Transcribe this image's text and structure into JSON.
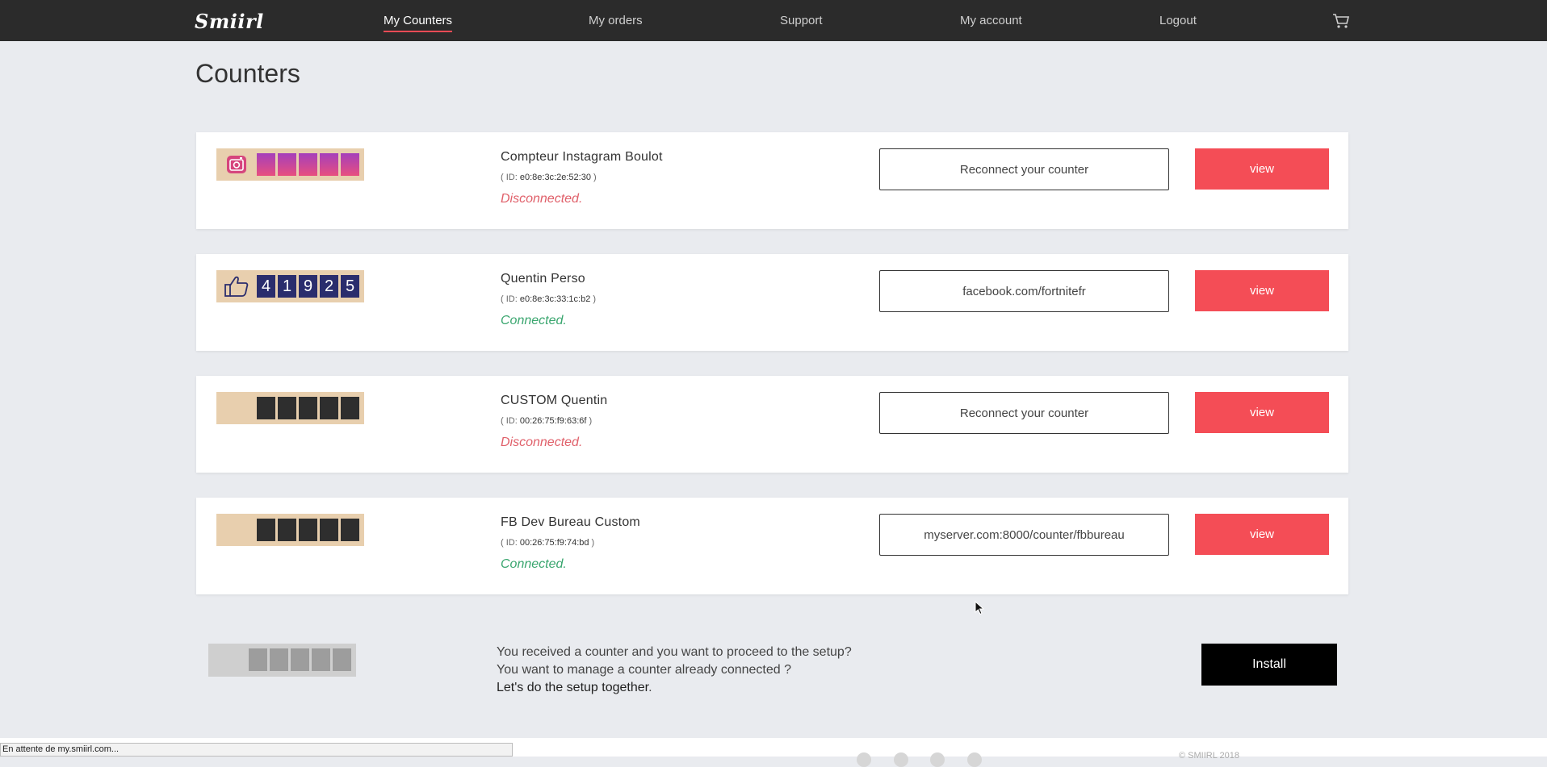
{
  "app": {
    "logo": "Smiirl"
  },
  "nav": [
    {
      "label": "My Counters",
      "active": true
    },
    {
      "label": "My orders",
      "active": false
    },
    {
      "label": "Support",
      "active": false
    },
    {
      "label": "My account",
      "active": false
    },
    {
      "label": "Logout",
      "active": false
    }
  ],
  "cart_icon": "cart-icon",
  "page": {
    "title": "Counters"
  },
  "counters": [
    {
      "name": "Compteur Instagram Boulot",
      "id_label": "ID:",
      "id": "e0:8e:3c:2e:52:30",
      "status": "Disconnected.",
      "status_kind": "disconnected",
      "field": "Reconnect your counter",
      "button": "view",
      "style": "instagram",
      "icon": "instagram-icon",
      "digits": [
        "",
        "",
        "",
        "",
        ""
      ]
    },
    {
      "name": "Quentin Perso",
      "id_label": "ID:",
      "id": "e0:8e:3c:33:1c:b2",
      "status": "Connected.",
      "status_kind": "connected",
      "field": "facebook.com/fortnitefr",
      "button": "view",
      "style": "facebook",
      "icon": "thumbs-up-icon",
      "digits": [
        "4",
        "1",
        "9",
        "2",
        "5"
      ]
    },
    {
      "name": "CUSTOM Quentin",
      "id_label": "ID:",
      "id": "00:26:75:f9:63:6f",
      "status": "Disconnected.",
      "status_kind": "disconnected",
      "field": "Reconnect your counter",
      "button": "view",
      "style": "custom",
      "icon": "",
      "digits": [
        "",
        "",
        "",
        "",
        ""
      ]
    },
    {
      "name": "FB Dev Bureau Custom",
      "id_label": "ID:",
      "id": "00:26:75:f9:74:bd",
      "status": "Connected.",
      "status_kind": "connected",
      "field": "myserver.com:8000/counter/fbbureau",
      "button": "view",
      "style": "custom",
      "icon": "",
      "digits": [
        "",
        "",
        "",
        "",
        ""
      ]
    }
  ],
  "install": {
    "text": "You received a counter and you want to proceed to the setup? You want to manage a counter already connected ?",
    "link": "Let's do the setup together",
    "link_suffix": ".",
    "button": "Install"
  },
  "footer": {
    "copyright": "© SMIIRL 2018"
  },
  "browser_status": "En attente de my.smiirl.com...",
  "colors": {
    "accent": "#f44d56",
    "connected": "#3aa66f",
    "disconnected": "#e0606a",
    "nav_bg": "#2b2b2b"
  }
}
